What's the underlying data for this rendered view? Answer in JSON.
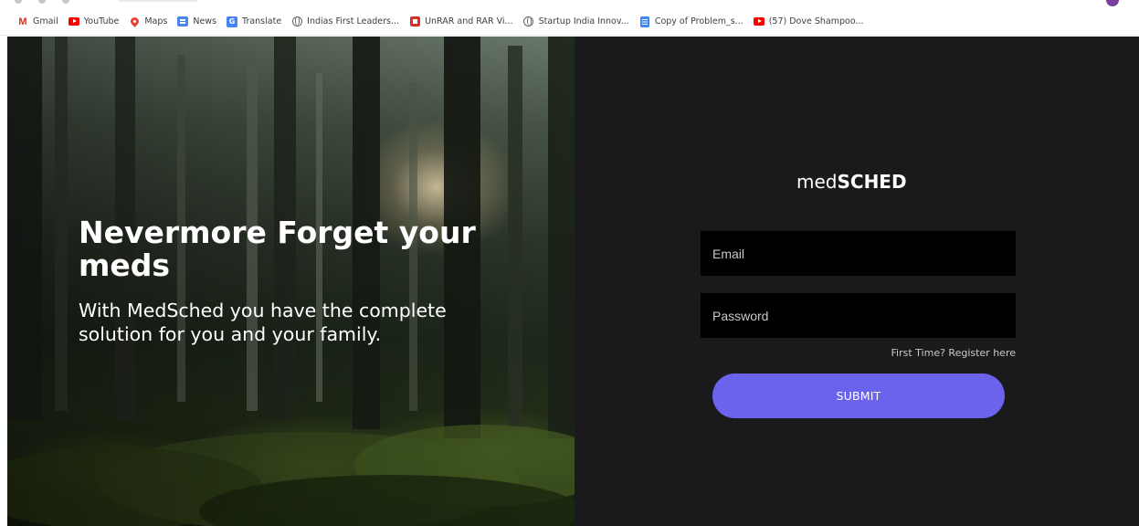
{
  "bookmarks": [
    {
      "icon": "gmail-icon",
      "label": "Gmail"
    },
    {
      "icon": "youtube-icon",
      "label": "YouTube"
    },
    {
      "icon": "maps-pin-icon",
      "label": "Maps"
    },
    {
      "icon": "news-icon",
      "label": "News"
    },
    {
      "icon": "translate-icon",
      "label": "Translate"
    },
    {
      "icon": "globe-icon",
      "label": "Indias First Leaders..."
    },
    {
      "icon": "unrar-icon",
      "label": "UnRAR and RAR Vi..."
    },
    {
      "icon": "globe-icon",
      "label": "Startup India Innov..."
    },
    {
      "icon": "document-icon",
      "label": "Copy of Problem_s..."
    },
    {
      "icon": "youtube-icon",
      "label": "(57) Dove Shampoo..."
    }
  ],
  "hero": {
    "headline": "Nevermore Forget your meds",
    "subtext": "With MedSched you have the complete solution for you and your family."
  },
  "login": {
    "logo_light": "med",
    "logo_bold": "SCHED",
    "email_placeholder": "Email",
    "password_placeholder": "Password",
    "register_link": "First Time? Register here",
    "submit_label": "SUBMIT"
  },
  "colors": {
    "panel_background": "#1a1a1c",
    "input_background": "#000000",
    "submit_button": "#6c63ec"
  }
}
